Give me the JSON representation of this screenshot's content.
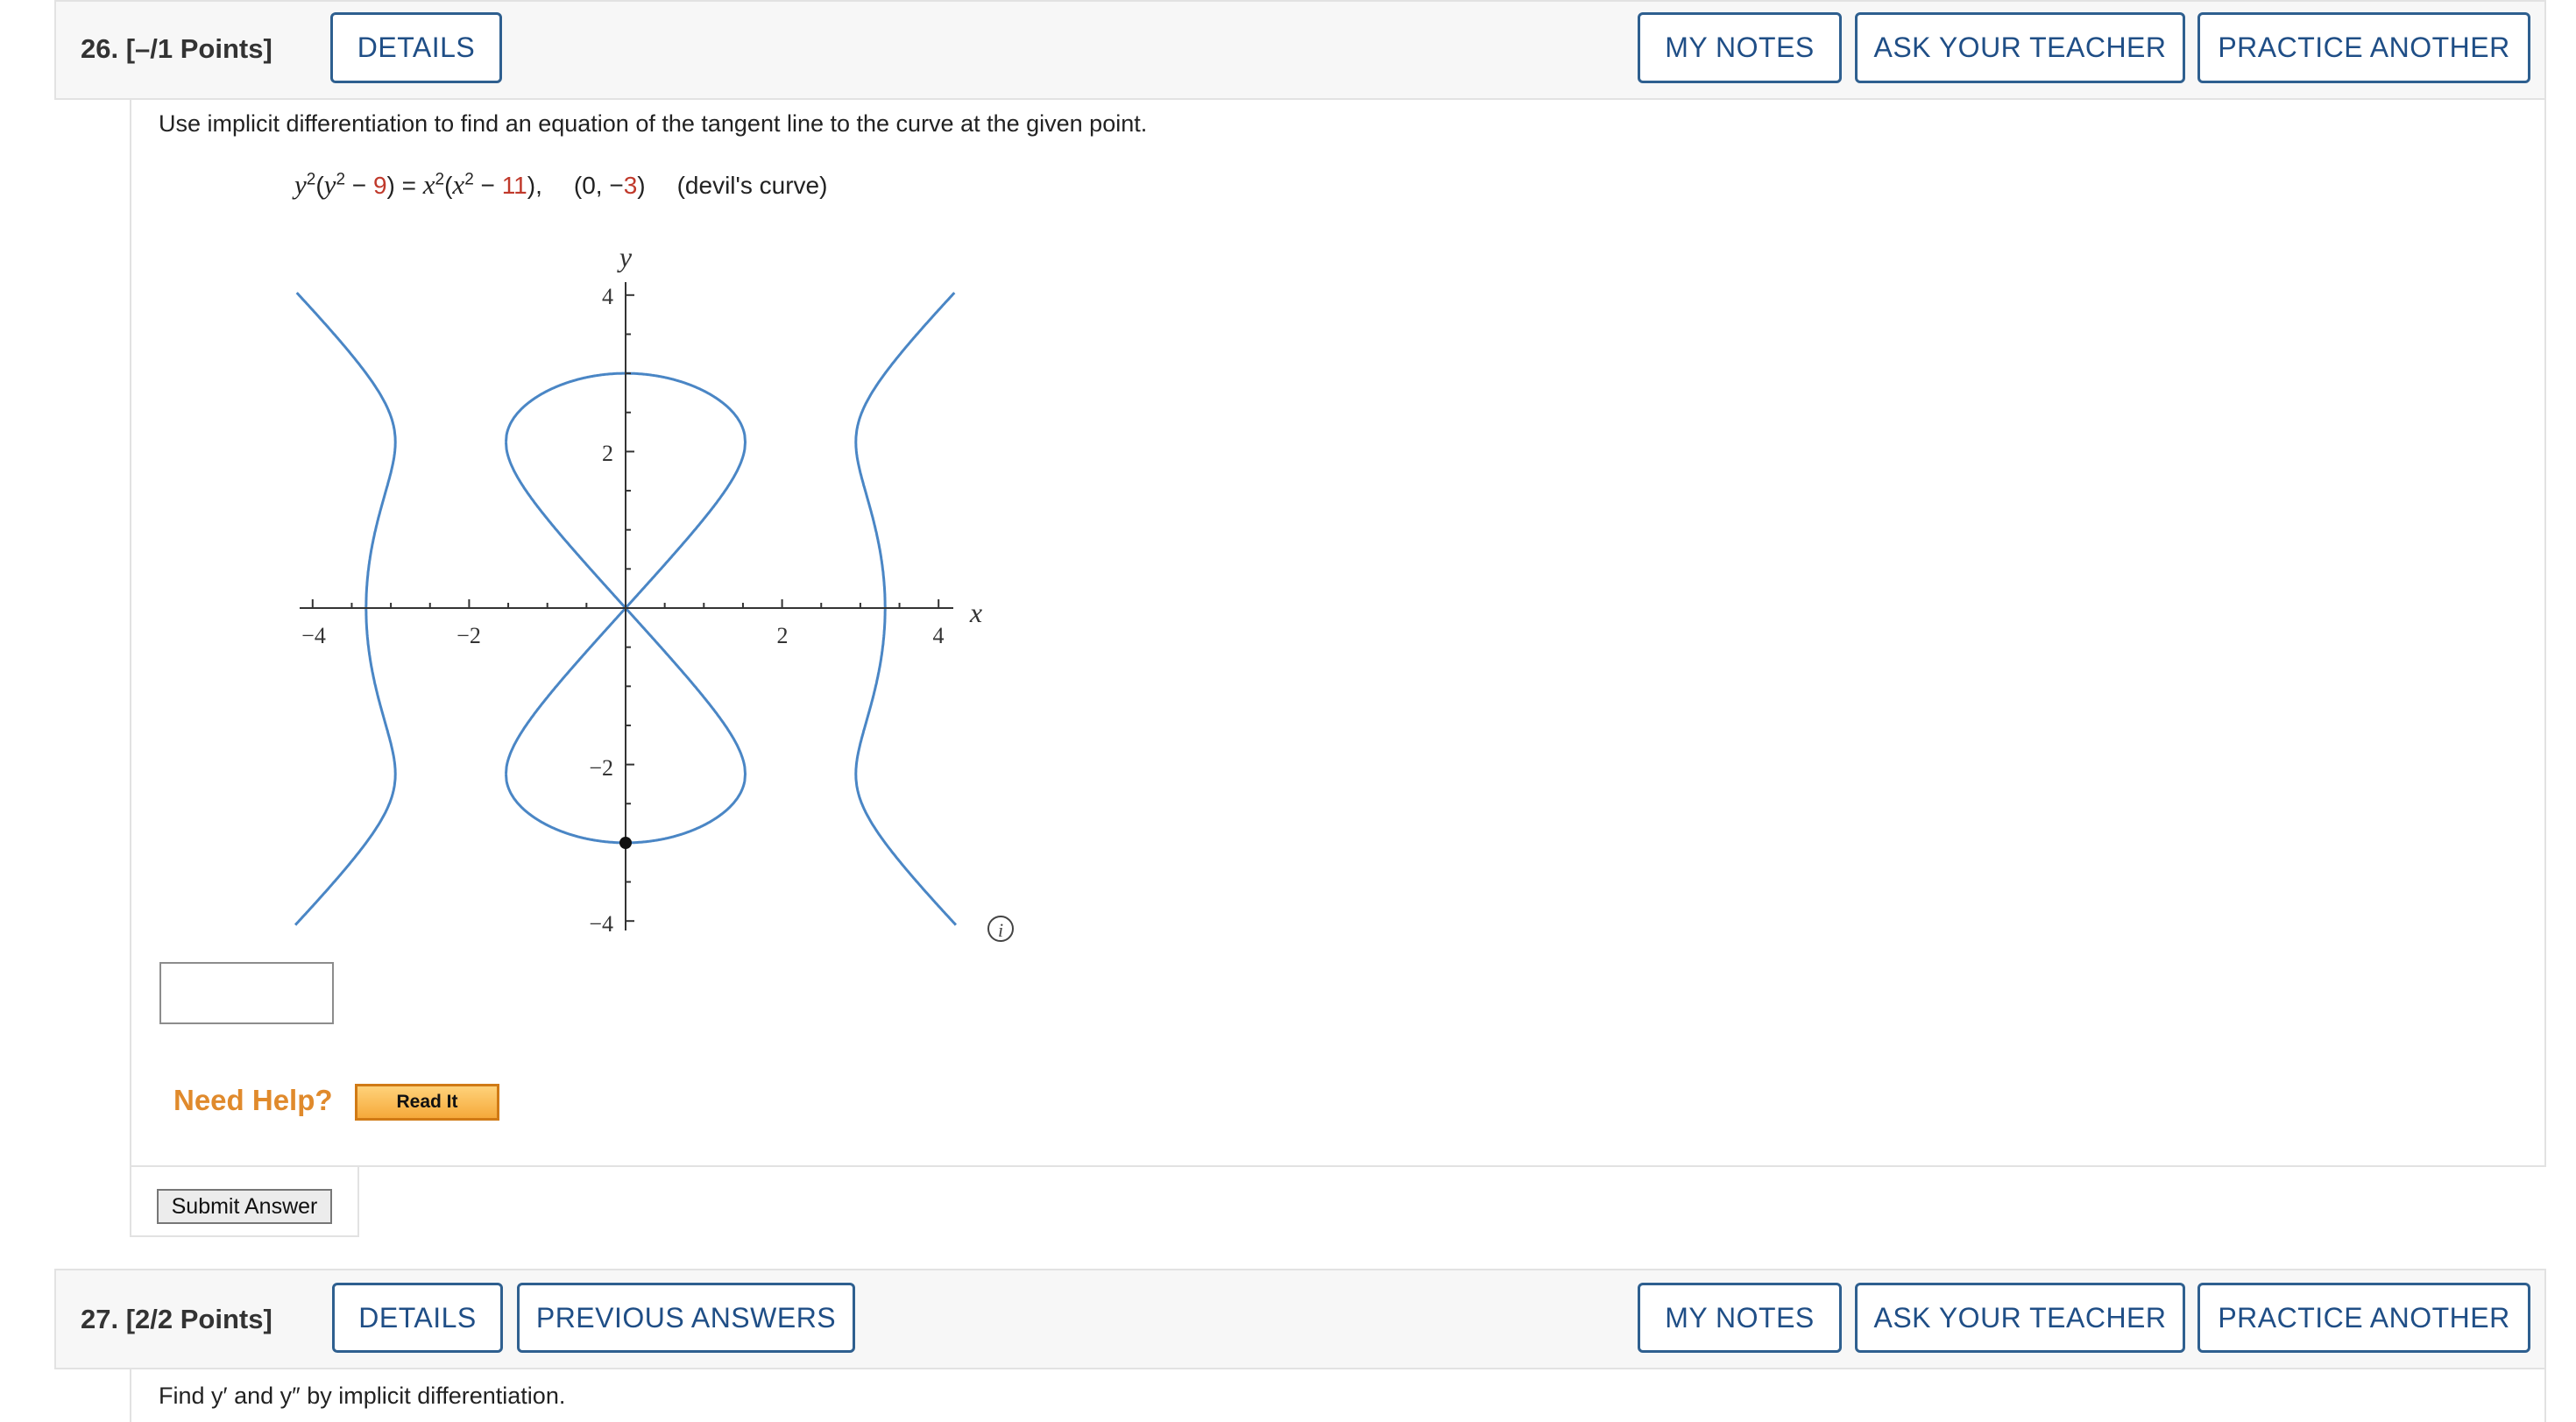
{
  "question26": {
    "number_label": "26.  [–/1 Points]",
    "details_label": "DETAILS",
    "my_notes_label": "MY NOTES",
    "ask_teacher_label": "ASK YOUR TEACHER",
    "practice_label": "PRACTICE ANOTHER",
    "instruction": "Use implicit differentiation to find an equation of the tangent line to the curve at the given point.",
    "equation": {
      "y_var": "y",
      "y_exp": "2",
      "open1": "(",
      "y_var2": "y",
      "y_exp2": "2",
      "minus1": " − ",
      "c1": "9",
      "close1": ") = ",
      "x_var": "x",
      "x_exp": "2",
      "open2": "(",
      "x_var2": "x",
      "x_exp2": "2",
      "minus2": " − ",
      "c2": "11",
      "close2": "),",
      "point_open": "(0, −",
      "point_y": "3",
      "point_close": ")",
      "name": "(devil's curve)"
    },
    "graph": {
      "y_axis_label": "y",
      "x_axis_label": "x",
      "x_ticks": [
        "−4",
        "−2",
        "2",
        "4"
      ],
      "y_ticks": [
        "4",
        "2",
        "−2",
        "−4"
      ],
      "curve_color": "#4a86c5",
      "info_icon": "info-circle-icon"
    },
    "answer_value": "",
    "need_help_label": "Need Help?",
    "read_it_label": "Read It",
    "submit_label": "Submit Answer"
  },
  "question27": {
    "number_label": "27.  [2/2 Points]",
    "details_label": "DETAILS",
    "previous_label": "PREVIOUS ANSWERS",
    "my_notes_label": "MY NOTES",
    "ask_teacher_label": "ASK YOUR TEACHER",
    "practice_label": "PRACTICE ANOTHER",
    "instruction": "Find y′ and y″ by implicit differentiation."
  },
  "colors": {
    "button_border": "#2e5f8f",
    "button_text": "#1f4e86",
    "need_help": "#e08a2c",
    "red_number": "#c0392b"
  }
}
